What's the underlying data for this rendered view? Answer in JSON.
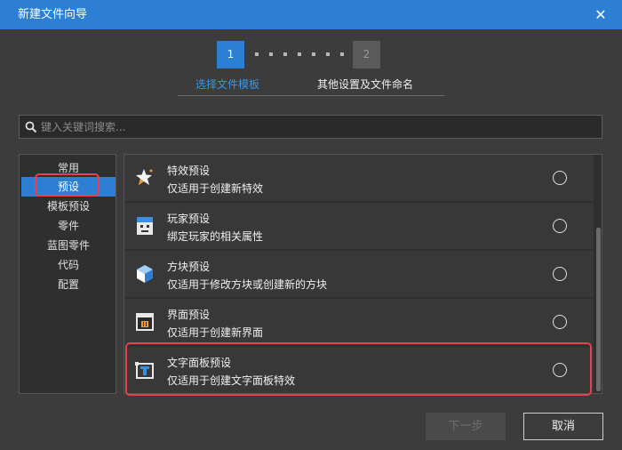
{
  "window": {
    "title": "新建文件向导",
    "close_glyph": "✕"
  },
  "steps": {
    "step1_number": "1",
    "step2_number": "2",
    "step1_label": "选择文件模板",
    "step2_label": "其他设置及文件命名",
    "active_color": "#2d7fd3"
  },
  "search": {
    "placeholder": "键入关键词搜索...",
    "value": "",
    "icon": "search-icon"
  },
  "categories": [
    {
      "label": "常用",
      "selected": false
    },
    {
      "label": "预设",
      "selected": true
    },
    {
      "label": "模板预设",
      "selected": false
    },
    {
      "label": "零件",
      "selected": false
    },
    {
      "label": "蓝图零件",
      "selected": false
    },
    {
      "label": "代码",
      "selected": false
    },
    {
      "label": "配置",
      "selected": false
    }
  ],
  "items": [
    {
      "title": "特效预设",
      "desc": "仅适用于创建新特效",
      "icon": "effect-star-icon",
      "selected": false
    },
    {
      "title": "玩家预设",
      "desc": "绑定玩家的相关属性",
      "icon": "player-icon",
      "selected": false
    },
    {
      "title": "方块预设",
      "desc": "仅适用于修改方块或创建新的方块",
      "icon": "cube-icon",
      "selected": false
    },
    {
      "title": "界面预设",
      "desc": "仅适用于创建新界面",
      "icon": "ui-window-icon",
      "selected": false
    },
    {
      "title": "文字面板预设",
      "desc": "仅适用于创建文字面板特效",
      "icon": "text-panel-icon",
      "selected": false
    }
  ],
  "buttons": {
    "next": "下一步",
    "cancel": "取消"
  },
  "highlight_color": "#e8404e"
}
